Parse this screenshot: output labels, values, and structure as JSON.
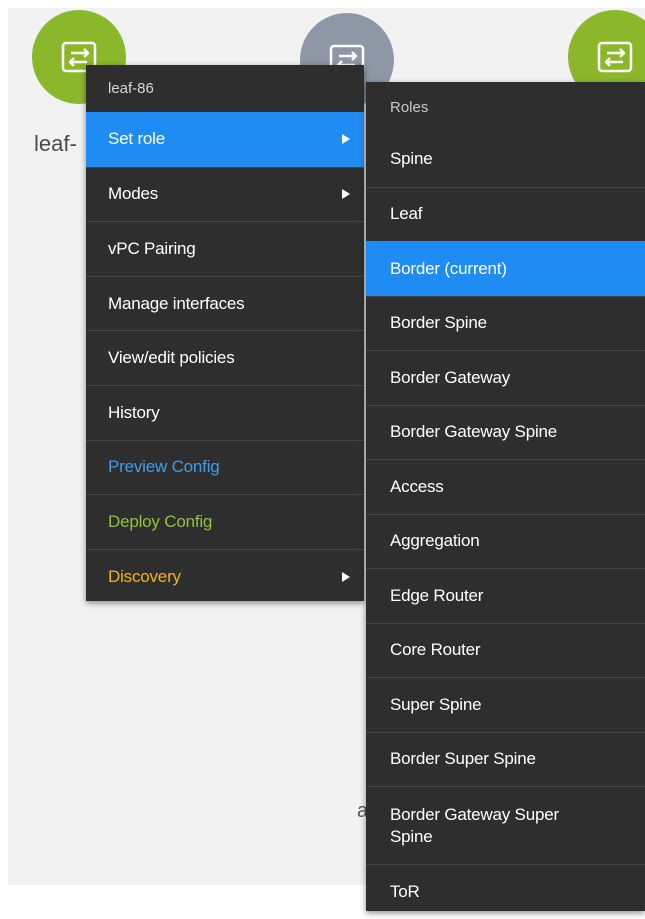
{
  "canvas": {
    "nodes": [
      {
        "label": "leaf-",
        "color": "#8bb82b",
        "icon": "switch-arrows-icon"
      },
      {
        "label": "",
        "color": "#8e97a6",
        "icon": "switch-arrows-icon"
      },
      {
        "label": "",
        "color": "#8bb82b",
        "icon": "switch-arrows-icon"
      }
    ],
    "background_fragment": "a"
  },
  "context_menu": {
    "header": "leaf-86",
    "items": [
      {
        "label": "Set role",
        "color": "#ffffff",
        "submenu": true,
        "active": true
      },
      {
        "label": "Modes",
        "color": "#ffffff",
        "submenu": true,
        "active": false
      },
      {
        "label": "vPC Pairing",
        "color": "#ffffff",
        "submenu": false,
        "active": false
      },
      {
        "label": "Manage interfaces",
        "color": "#ffffff",
        "submenu": false,
        "active": false
      },
      {
        "label": "View/edit policies",
        "color": "#ffffff",
        "submenu": false,
        "active": false
      },
      {
        "label": "History",
        "color": "#ffffff",
        "submenu": false,
        "active": false
      },
      {
        "label": "Preview Config",
        "color": "#3d9ee8",
        "submenu": false,
        "active": false
      },
      {
        "label": "Deploy Config",
        "color": "#8cc43c",
        "submenu": false,
        "active": false
      },
      {
        "label": "Discovery",
        "color": "#f2b21b",
        "submenu": true,
        "active": false
      }
    ],
    "active_color": "#1e8cf2"
  },
  "roles_menu": {
    "header": "Roles",
    "items": [
      {
        "label": "Spine",
        "active": false
      },
      {
        "label": "Leaf",
        "active": false
      },
      {
        "label": "Border (current)",
        "active": true
      },
      {
        "label": "Border Spine",
        "active": false
      },
      {
        "label": "Border Gateway",
        "active": false
      },
      {
        "label": "Border Gateway Spine",
        "active": false
      },
      {
        "label": "Access",
        "active": false
      },
      {
        "label": "Aggregation",
        "active": false
      },
      {
        "label": "Edge Router",
        "active": false
      },
      {
        "label": "Core Router",
        "active": false
      },
      {
        "label": "Super Spine",
        "active": false
      },
      {
        "label": "Border Super Spine",
        "active": false
      },
      {
        "label": "Border Gateway Super Spine",
        "active": false
      },
      {
        "label": "ToR",
        "active": false
      }
    ]
  }
}
